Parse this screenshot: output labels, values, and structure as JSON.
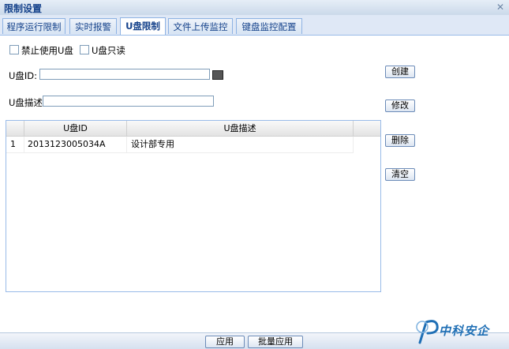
{
  "window": {
    "title": "限制设置",
    "close_icon": "close-icon"
  },
  "tabs": [
    {
      "label": "程序运行限制",
      "active": false
    },
    {
      "label": "实时报警",
      "active": false
    },
    {
      "label": "U盘限制",
      "active": true
    },
    {
      "label": "文件上传监控",
      "active": false
    },
    {
      "label": "键盘监控配置",
      "active": false
    }
  ],
  "options": {
    "forbid_usb_label": "禁止使用U盘",
    "readonly_usb_label": "U盘只读"
  },
  "form": {
    "usb_id_label": "U盘ID:",
    "usb_id_value": "",
    "usb_desc_label": "U盘描述:",
    "usb_desc_value": ""
  },
  "table": {
    "columns": [
      "",
      "U盘ID",
      "U盘描述"
    ],
    "rows": [
      {
        "num": "1",
        "usb_id": "2013123005034A",
        "desc": "设计部专用"
      }
    ]
  },
  "side_buttons": {
    "create": "创建",
    "modify": "修改",
    "delete": "删除",
    "clear": "清空"
  },
  "footer": {
    "apply": "应用",
    "batch_apply": "批量应用"
  },
  "brand": {
    "text": "中科安企",
    "color": "#1f6fb5"
  }
}
